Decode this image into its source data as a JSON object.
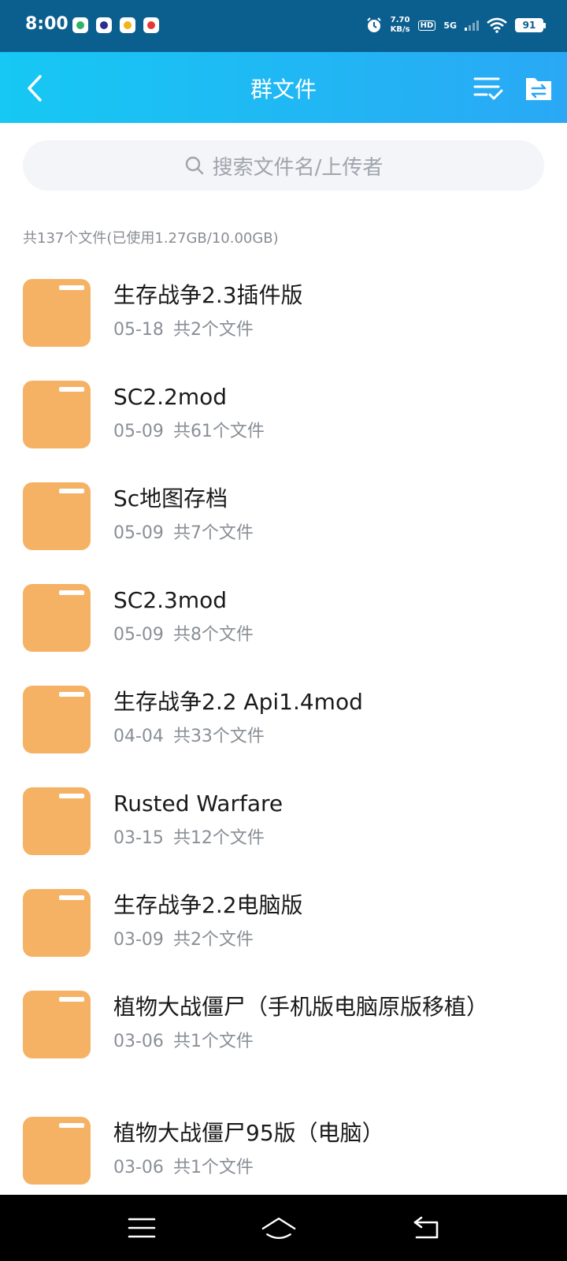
{
  "status_bar": {
    "time": "8:00",
    "speed_value": "7.70",
    "speed_unit": "KB/s",
    "hd": "HD",
    "network": "5G",
    "battery": "91"
  },
  "header": {
    "title": "群文件"
  },
  "search": {
    "placeholder": "搜索文件名/上传者"
  },
  "summary": "共137个文件(已使用1.27GB/10.00GB)",
  "files": [
    {
      "name": "生存战争2.3插件版",
      "date": "05-18",
      "count": "共2个文件"
    },
    {
      "name": "SC2.2mod",
      "date": "05-09",
      "count": "共61个文件"
    },
    {
      "name": "Sc地图存档",
      "date": "05-09",
      "count": "共7个文件"
    },
    {
      "name": "SC2.3mod",
      "date": "05-09",
      "count": "共8个文件"
    },
    {
      "name": "生存战争2.2 Api1.4mod",
      "date": "04-04",
      "count": "共33个文件"
    },
    {
      "name": "Rusted Warfare",
      "date": "03-15",
      "count": "共12个文件"
    },
    {
      "name": "生存战争2.2电脑版",
      "date": "03-09",
      "count": "共2个文件"
    },
    {
      "name": "植物大战僵尸（手机版电脑原版移植）",
      "date": "03-06",
      "count": "共1个文件"
    },
    {
      "name": "植物大战僵尸95版（电脑）",
      "date": "03-06",
      "count": "共1个文件"
    }
  ],
  "colors": {
    "status_bar": "#0b5f8f",
    "header_start": "#16c8f3",
    "header_end": "#2aa8f5",
    "folder": "#f5b265",
    "folder_label": "#ffffff"
  }
}
